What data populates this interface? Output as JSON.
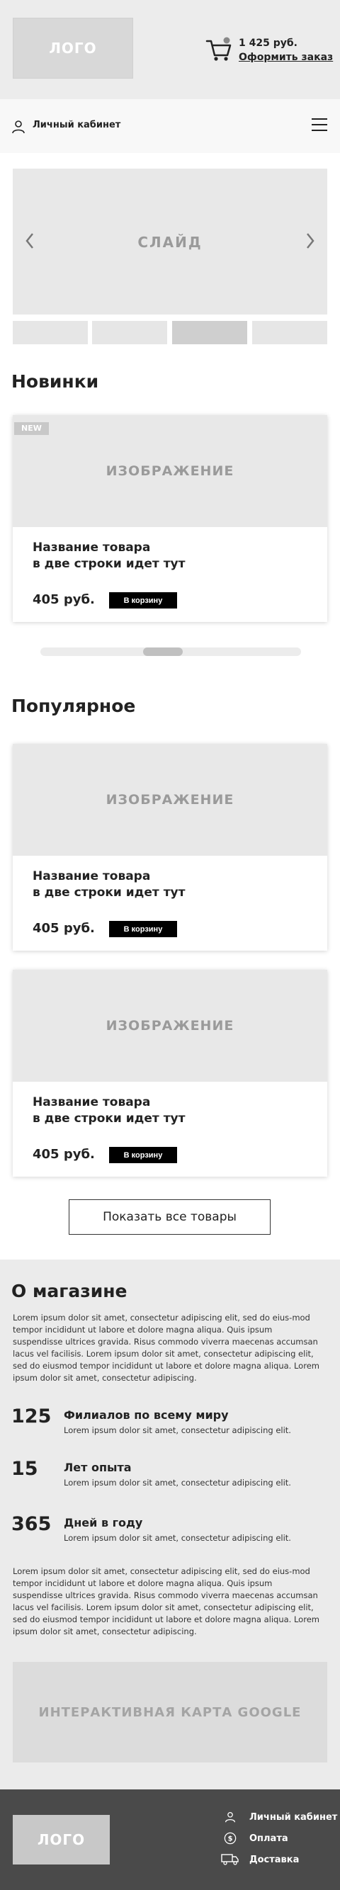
{
  "header": {
    "logo": "ЛОГО",
    "cart_price": "1 425 руб.",
    "cart_link": "Оформить заказ"
  },
  "account_bar": {
    "label": "Личный кабинет"
  },
  "slider": {
    "label": "СЛАЙД",
    "thumb_count": 4,
    "active_thumb": 3
  },
  "new_section": {
    "title": "Новинки",
    "products": [
      {
        "badge": "NEW",
        "image": "ИЗОБРАЖЕНИЕ",
        "title_line1": "Название товара",
        "title_line2": "в две строки идет тут",
        "price": "405 руб.",
        "button": "В корзину"
      }
    ]
  },
  "popular_section": {
    "title": "Популярное",
    "products": [
      {
        "image": "ИЗОБРАЖЕНИЕ",
        "title_line1": "Название товара",
        "title_line2": "в две строки идет тут",
        "price": "405 руб.",
        "button": "В корзину"
      },
      {
        "image": "ИЗОБРАЖЕНИЕ",
        "title_line1": "Название товара",
        "title_line2": "в две строки идет тут",
        "price": "405 руб.",
        "button": "В корзину"
      }
    ],
    "show_all": "Показать все товары"
  },
  "about": {
    "title": "О магазине",
    "text1": "Lorem ipsum dolor sit amet, consectetur adipiscing elit, sed do eius-mod tempor incididunt ut labore et dolore magna aliqua. Quis ipsum suspendisse ultrices gravida. Risus commodo viverra maecenas accumsan lacus vel facilisis. Lorem ipsum dolor sit amet, consectetur adipiscing elit, sed do eiusmod tempor incididunt ut labore et dolore magna aliqua. Lorem ipsum dolor sit amet, consectetur adipiscing.",
    "stats": [
      {
        "number": "125",
        "title": "Филиалов по всему миру",
        "desc": "Lorem ipsum dolor sit amet, consectetur adipiscing elit."
      },
      {
        "number": "15",
        "title": "Лет опыта",
        "desc": "Lorem ipsum dolor sit amet, consectetur adipiscing elit."
      },
      {
        "number": "365",
        "title": "Дней в году",
        "desc": "Lorem ipsum dolor sit amet, consectetur adipiscing elit."
      }
    ],
    "text2": "Lorem ipsum dolor sit amet, consectetur adipiscing elit, sed do eius-mod tempor incididunt ut labore et dolore magna aliqua. Quis ipsum suspendisse ultrices gravida. Risus commodo viverra maecenas accumsan lacus vel facilisis. Lorem ipsum dolor sit amet, consectetur adipiscing elit, sed do eiusmod tempor incididunt ut labore et dolore magna aliqua. Lorem ipsum dolor sit amet, consectetur adipiscing.",
    "map": "ИНТЕРАКТИВНАЯ КАРТА GOOGLE"
  },
  "footer": {
    "logo": "ЛОГО",
    "links": [
      {
        "label": "Личный кабинет",
        "icon": "user-icon"
      },
      {
        "label": "Оплата",
        "icon": "dollar-icon"
      },
      {
        "label": "Доставка",
        "icon": "truck-icon"
      }
    ]
  },
  "colors": {
    "header_bg": "#ececec",
    "placeholder": "#e8e8e8",
    "button_bg": "#000000",
    "footer_bg": "#4a4a4a"
  }
}
